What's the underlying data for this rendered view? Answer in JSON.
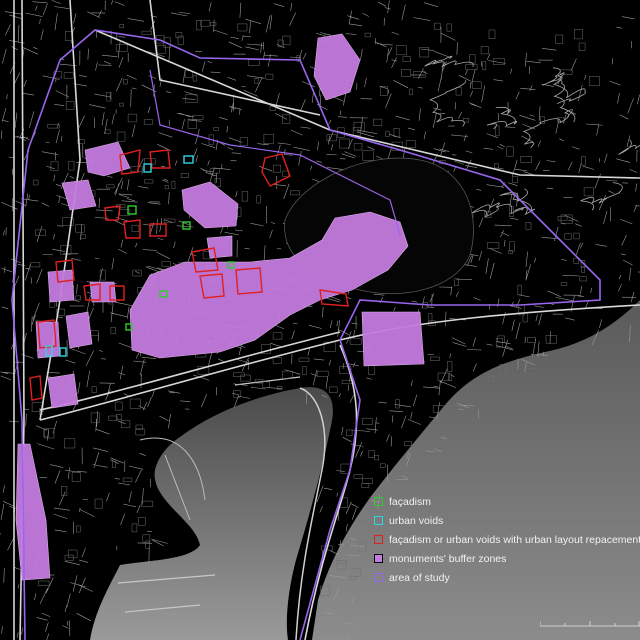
{
  "map": {
    "colors": {
      "background": "#000000",
      "streets": "#bdbdbd",
      "buildings": "#8a8a8a",
      "sea": "#7a7a7a",
      "buffer": "#c47bdf",
      "study_area": "#9966ee",
      "facadism": "#2ecc2e",
      "voids": "#2fd6e0",
      "facadism_voids_replacement": "#e02020"
    }
  },
  "legend": {
    "items": [
      {
        "label": "façadism",
        "color": "#2ecc2e",
        "style": "outline"
      },
      {
        "label": "urban voids",
        "color": "#2fd6e0",
        "style": "outline"
      },
      {
        "label": "façadism or urban voids with urban layout repacement",
        "color": "#e02020",
        "style": "outline"
      },
      {
        "label": "monuments' buffer zones",
        "color": "#c47bdf",
        "style": "fill"
      },
      {
        "label": "area of study",
        "color": "#9966ee",
        "style": "outline"
      }
    ]
  }
}
